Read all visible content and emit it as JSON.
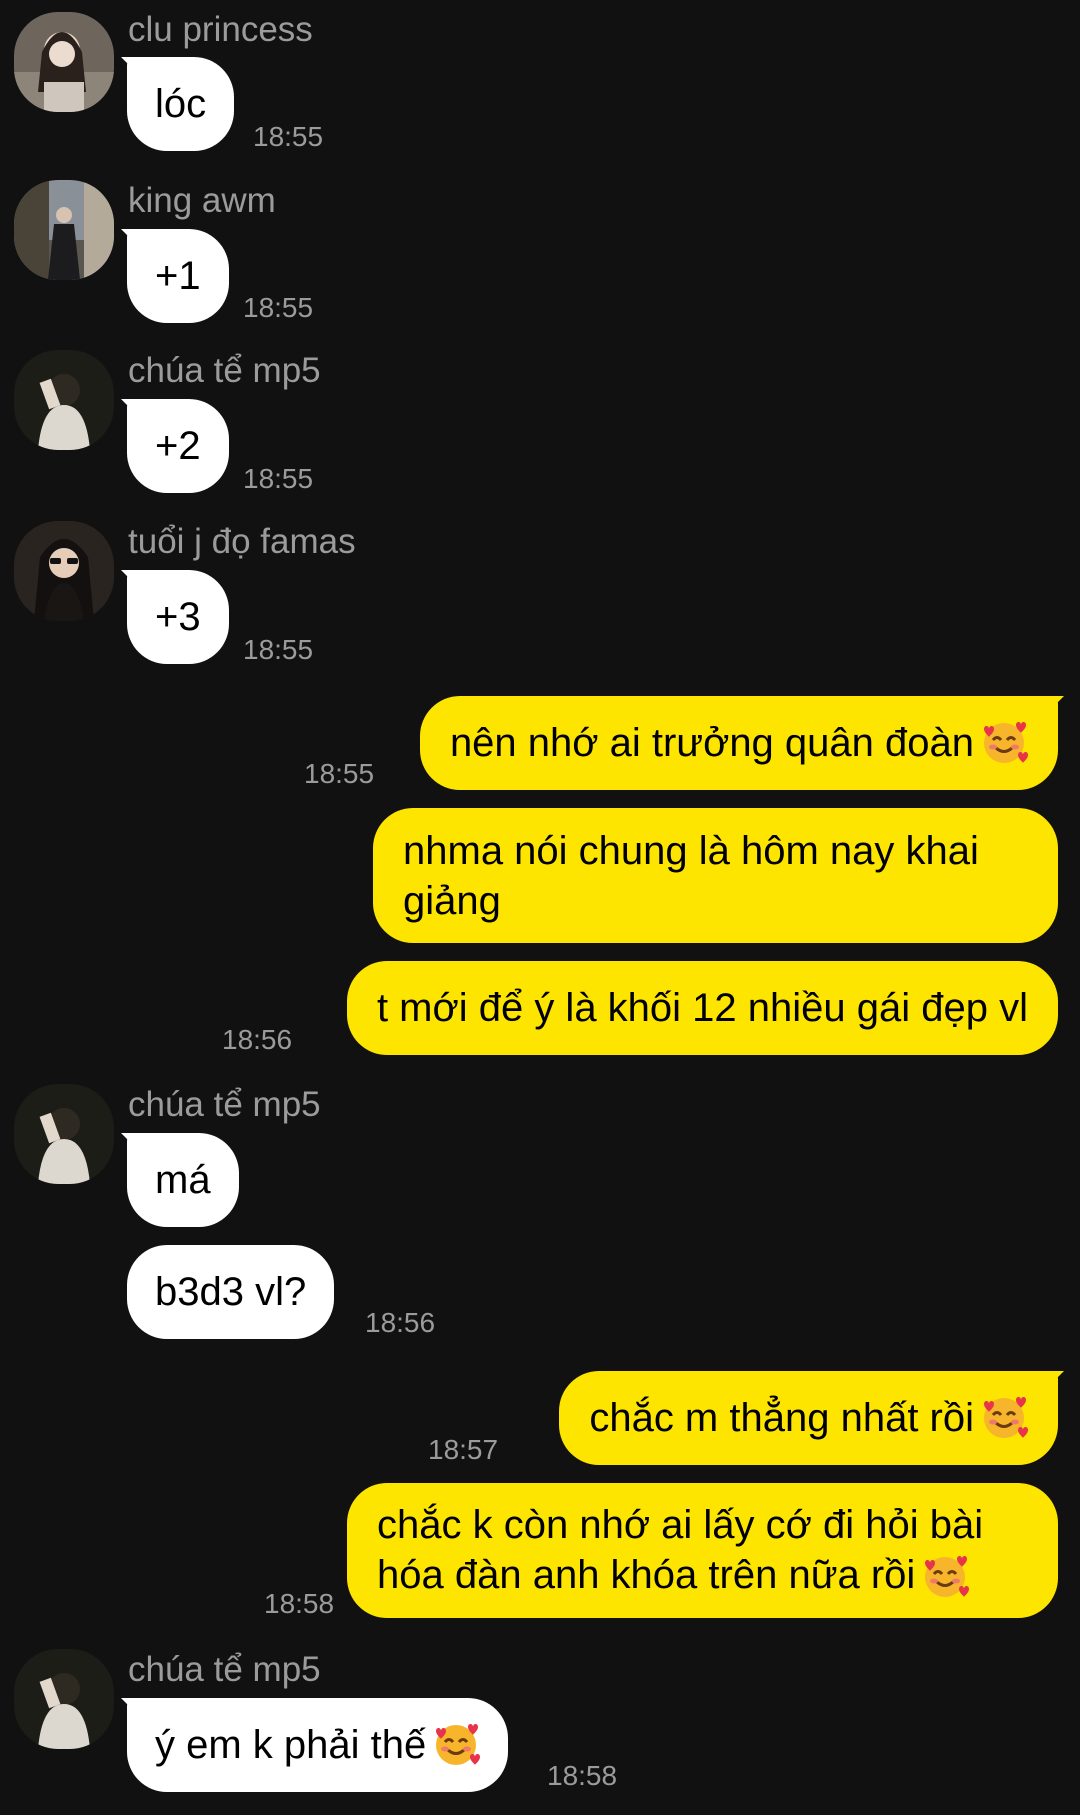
{
  "messages": [
    {
      "sender": "clu princess",
      "text": "lóc",
      "time": "18:55"
    },
    {
      "sender": "king awm",
      "text": "+1",
      "time": "18:55"
    },
    {
      "sender": "chúa tể mp5",
      "text": "+2",
      "time": "18:55"
    },
    {
      "sender": "tuổi j đọ famas",
      "text": "+3",
      "time": "18:55"
    },
    {
      "sender": "me",
      "text": "nên nhớ ai trưởng quân đoàn",
      "time": "18:55",
      "emoji": "smiling-face-with-hearts"
    },
    {
      "sender": "me",
      "text": "nhma nói chung là hôm nay khai giảng"
    },
    {
      "sender": "me",
      "text": "t mới để ý là khối 12 nhiều gái đẹp vl",
      "time": "18:56"
    },
    {
      "sender": "chúa tể mp5",
      "text": "má"
    },
    {
      "sender": "chúa tể mp5",
      "text": "b3d3 vl?",
      "time": "18:56"
    },
    {
      "sender": "me",
      "text": "chắc m thẳng nhất rồi",
      "time": "18:57",
      "emoji": "smiling-face-with-hearts"
    },
    {
      "sender": "me",
      "text": "chắc k còn nhớ ai lấy cớ đi hỏi bài hóa đàn anh khóa trên nữa rồi",
      "time": "18:58",
      "emoji": "smiling-face-with-hearts"
    },
    {
      "sender": "chúa tể mp5",
      "text": "ý em k phải thế",
      "time": "18:58",
      "emoji": "smiling-face-with-hearts"
    }
  ],
  "colors": {
    "background": "#111111",
    "incoming_bubble": "#ffffff",
    "outgoing_bubble": "#fee500",
    "meta_text": "#9b9b9b"
  }
}
